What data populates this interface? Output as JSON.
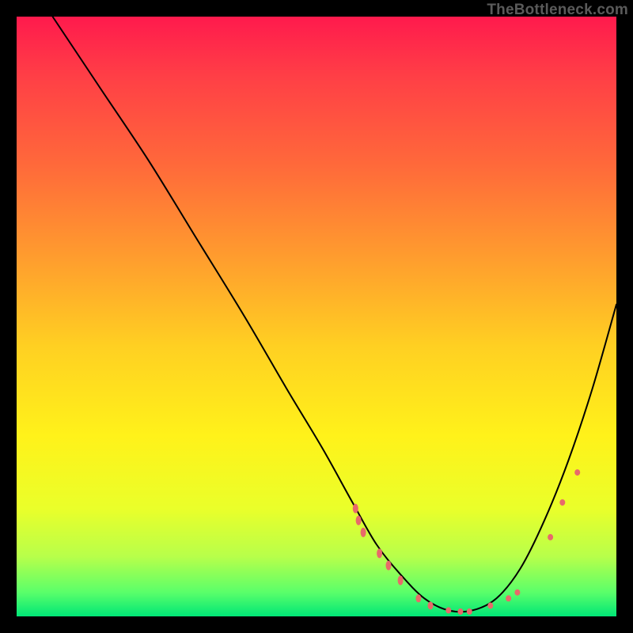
{
  "watermark": "TheBottleneck.com",
  "chart_data": {
    "type": "line",
    "title": "",
    "xlabel": "",
    "ylabel": "",
    "xlim": [
      0,
      100
    ],
    "ylim": [
      0,
      100
    ],
    "grid": false,
    "series": [
      {
        "name": "curve",
        "stroke": "#000000",
        "stroke_width": 2,
        "x": [
          6,
          14,
          22,
          30,
          38,
          45,
          51,
          56,
          60,
          64,
          68,
          72,
          76,
          80,
          84,
          88,
          92,
          96,
          100
        ],
        "y": [
          100,
          88,
          76,
          63,
          50,
          38,
          28,
          19,
          12,
          7,
          3,
          1,
          1,
          3,
          8,
          16,
          26,
          38,
          52
        ]
      }
    ],
    "markers": [
      {
        "x": 56.5,
        "y": 18.0,
        "rx": 3.5,
        "ry": 6
      },
      {
        "x": 57.0,
        "y": 16.0,
        "rx": 3.5,
        "ry": 6
      },
      {
        "x": 57.8,
        "y": 14.0,
        "rx": 3.5,
        "ry": 6
      },
      {
        "x": 60.5,
        "y": 10.5,
        "rx": 3.5,
        "ry": 6
      },
      {
        "x": 62.0,
        "y": 8.5,
        "rx": 3.5,
        "ry": 6
      },
      {
        "x": 64.0,
        "y": 6.0,
        "rx": 3.5,
        "ry": 6
      },
      {
        "x": 67.0,
        "y": 3.0,
        "rx": 3.5,
        "ry": 5
      },
      {
        "x": 69.0,
        "y": 1.8,
        "rx": 3.5,
        "ry": 5
      },
      {
        "x": 72.0,
        "y": 1.0,
        "rx": 3.5,
        "ry": 4
      },
      {
        "x": 74.0,
        "y": 0.8,
        "rx": 3.5,
        "ry": 4
      },
      {
        "x": 75.5,
        "y": 0.8,
        "rx": 3.5,
        "ry": 4
      },
      {
        "x": 79.0,
        "y": 1.8,
        "rx": 3.5,
        "ry": 4
      },
      {
        "x": 82.0,
        "y": 3.0,
        "rx": 3.5,
        "ry": 4
      },
      {
        "x": 83.5,
        "y": 4.0,
        "rx": 3.5,
        "ry": 4
      },
      {
        "x": 89.0,
        "y": 13.2,
        "rx": 3.5,
        "ry": 4
      },
      {
        "x": 91.0,
        "y": 19.0,
        "rx": 3.5,
        "ry": 4
      },
      {
        "x": 93.5,
        "y": 24.0,
        "rx": 3.5,
        "ry": 4
      }
    ],
    "marker_fill": "#e86a6a"
  }
}
